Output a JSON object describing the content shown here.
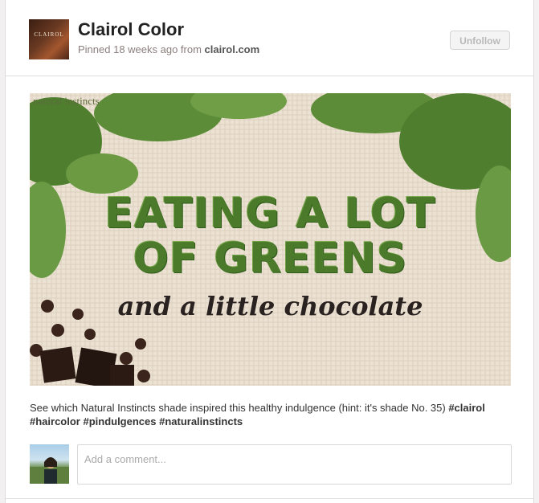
{
  "pin": {
    "brand_name": "Clairol Color",
    "logo_text": "CLAIROL",
    "pinned_prefix": "Pinned 18 weeks ago from ",
    "source_domain": "clairol.com",
    "unfollow_label": "Unfollow",
    "image": {
      "brand_mark": "natural instincts",
      "headline_line1": "EATING A LOT",
      "headline_line2": "OF GREENS",
      "subline": "and a little chocolate"
    },
    "description_text": "See which Natural Instincts shade inspired this healthy indulgence (hint: it's shade No. 35) ",
    "description_tags": "#clairol #haircolor #pindulgences #naturalinstincts"
  },
  "comment": {
    "placeholder": "Add a comment..."
  },
  "colors": {
    "kale_green": "#4a7a2a",
    "chocolate": "#2b1a14",
    "burlap": "#ede4d6"
  }
}
